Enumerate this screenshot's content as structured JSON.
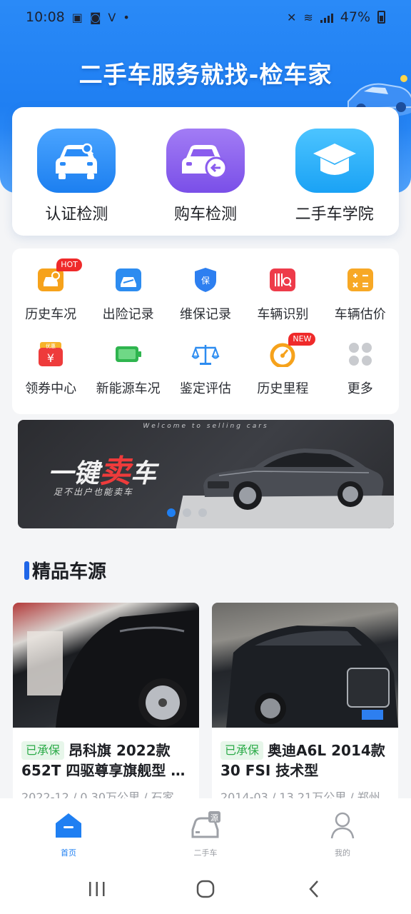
{
  "status_bar": {
    "time": "10:08",
    "battery": "47%"
  },
  "hero": {
    "title": "二手车服务就找-检车家"
  },
  "services": [
    {
      "label": "认证检测",
      "icon": "car-search-icon",
      "color": "#2b8cf7"
    },
    {
      "label": "购车检测",
      "icon": "car-return-icon",
      "color": "#8a5cee"
    },
    {
      "label": "二手车学院",
      "icon": "graduation-cap-icon",
      "color": "#29b1f8"
    }
  ],
  "tools": [
    {
      "label": "历史车况",
      "icon": "car-history-icon",
      "tag": "HOT"
    },
    {
      "label": "出险记录",
      "icon": "accident-record-icon"
    },
    {
      "label": "维保记录",
      "icon": "maintenance-shield-icon",
      "icon_text": "保"
    },
    {
      "label": "车辆识别",
      "icon": "barcode-scan-icon"
    },
    {
      "label": "车辆估价",
      "icon": "calculator-icon"
    },
    {
      "label": "领券中心",
      "icon": "coupon-icon",
      "icon_text": "优惠"
    },
    {
      "label": "新能源车况",
      "icon": "battery-icon"
    },
    {
      "label": "鉴定评估",
      "icon": "scale-icon"
    },
    {
      "label": "历史里程",
      "icon": "speedometer-icon",
      "tag": "NEW"
    },
    {
      "label": "更多",
      "icon": "more-grid-icon"
    }
  ],
  "banner": {
    "welcome": "Welcome to selling cars",
    "title_prefix": "一键",
    "title_highlight": "卖",
    "title_suffix": "车",
    "subtitle": "足不出户也能卖车",
    "slides": 3,
    "active_slide": 1
  },
  "section": {
    "title": "精品车源"
  },
  "listings": [
    {
      "badge": "已承保",
      "title": "昂科旗 2022款 652T 四驱尊享旗舰型 …",
      "meta": "2022-12 / 0.30万公里 / 石家"
    },
    {
      "badge": "已承保",
      "title": "奥迪A6L 2014款 30 FSI 技术型",
      "meta": "2014-03 / 13.21万公里 / 郑州"
    }
  ],
  "bottom_nav": [
    {
      "label": "首页",
      "icon": "home-icon",
      "active": true
    },
    {
      "label": "二手车",
      "icon": "used-car-icon",
      "icon_text": "源",
      "active": false
    },
    {
      "label": "我的",
      "icon": "profile-icon",
      "active": false
    }
  ],
  "colors": {
    "primary": "#1f7ff2",
    "hot_tag": "#ef2a2a",
    "insured_badge": "#2bab48"
  }
}
